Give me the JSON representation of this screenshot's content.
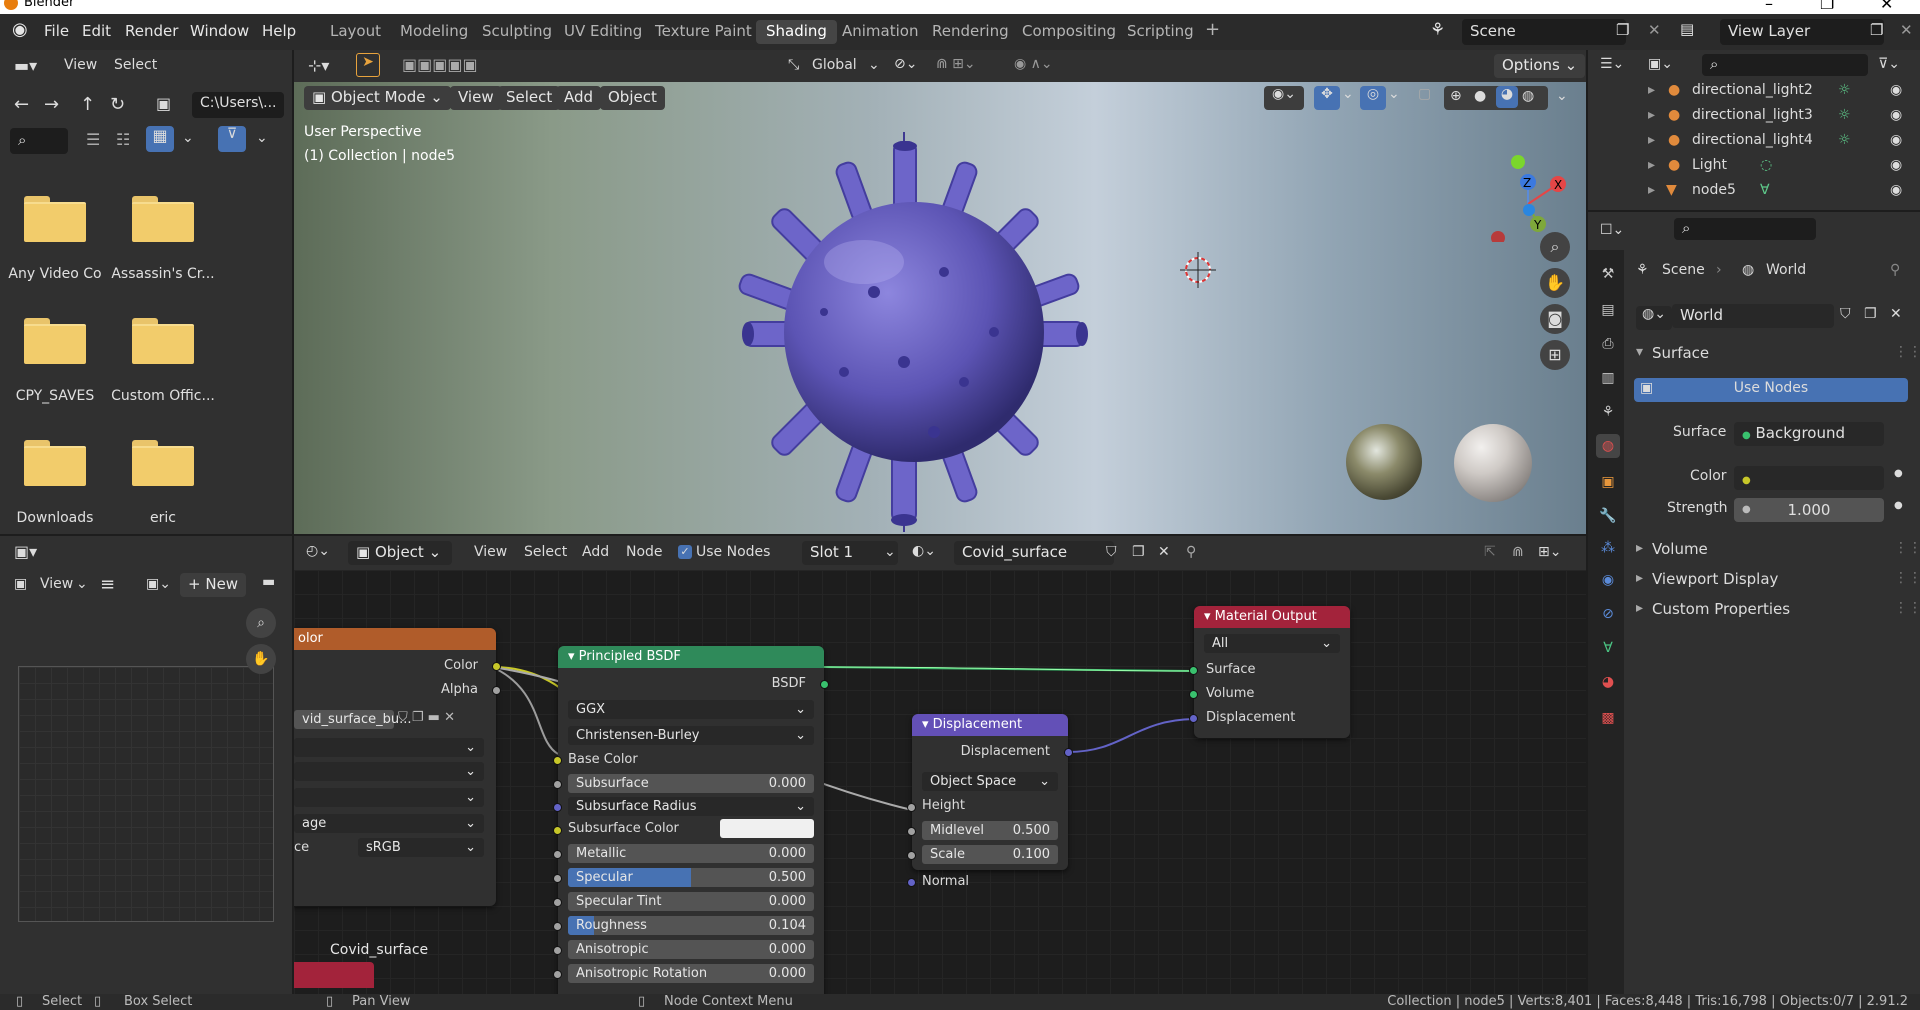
{
  "window": {
    "title": "Blender"
  },
  "menu": [
    "File",
    "Edit",
    "Render",
    "Window",
    "Help"
  ],
  "workspaces": [
    "Layout",
    "Modeling",
    "Sculpting",
    "UV Editing",
    "Texture Paint",
    "Shading",
    "Animation",
    "Rendering",
    "Compositing",
    "Scripting"
  ],
  "active_workspace": "Shading",
  "scene": "Scene",
  "view_layer": "View Layer",
  "filebrowser": {
    "menu": [
      "View",
      "Select"
    ],
    "path": "C:\\Users\\...",
    "folders": [
      "Any Video Co",
      "Assassin's Cr...",
      "CPY_SAVES",
      "Custom Offic...",
      "Downloads",
      "eric"
    ]
  },
  "viewport": {
    "header": {
      "global": "Global",
      "options": "Options"
    },
    "mode": "Object Mode",
    "menus": [
      "View",
      "Select",
      "Add",
      "Object"
    ],
    "info1": "User Perspective",
    "info2": "(1) Collection | node5",
    "gizmo": {
      "x": "X",
      "y": "Y",
      "z": "Z"
    }
  },
  "imageeditor": {
    "view": "View",
    "new": "New"
  },
  "nodeeditor": {
    "type": "Object",
    "menus": [
      "View",
      "Select",
      "Add",
      "Node"
    ],
    "use_nodes": "Use Nodes",
    "slot": "Slot 1",
    "material": "Covid_surface",
    "frame_label": "Covid_surface",
    "image_node": {
      "title": "olor",
      "out_color": "Color",
      "out_alpha": "Alpha",
      "image": "vid_surface_bu...",
      "row_age": "age",
      "row_ce": "ce",
      "colorspace": "sRGB"
    },
    "bsdf": {
      "title": "Principled BSDF",
      "out": "BSDF",
      "distribution": "GGX",
      "subsurface_method": "Christensen-Burley",
      "base_color": "Base Color",
      "subsurface": {
        "label": "Subsurface",
        "value": "0.000"
      },
      "subsurface_radius": "Subsurface Radius",
      "subsurface_color": "Subsurface Color",
      "metallic": {
        "label": "Metallic",
        "value": "0.000"
      },
      "specular": {
        "label": "Specular",
        "value": "0.500",
        "fill": 0.5
      },
      "specular_tint": {
        "label": "Specular Tint",
        "value": "0.000"
      },
      "roughness": {
        "label": "Roughness",
        "value": "0.104",
        "fill": 0.104
      },
      "anisotropic": {
        "label": "Anisotropic",
        "value": "0.000"
      },
      "anisotropic_rotation": {
        "label": "Anisotropic Rotation",
        "value": "0.000"
      }
    },
    "displacement": {
      "title": "Displacement",
      "out": "Displacement",
      "space": "Object Space",
      "height": "Height",
      "midlevel": {
        "label": "Midlevel",
        "value": "0.500"
      },
      "scale": {
        "label": "Scale",
        "value": "0.100"
      },
      "normal": "Normal"
    },
    "output": {
      "title": "Material Output",
      "target": "All",
      "surface": "Surface",
      "volume": "Volume",
      "displacement": "Displacement"
    }
  },
  "outliner": {
    "items": [
      "directional_light2",
      "directional_light3",
      "directional_light4",
      "Light",
      "node5"
    ]
  },
  "properties": {
    "breadcrumb": {
      "scene": "Scene",
      "world": "World"
    },
    "world_name": "World",
    "surface_panel": "Surface",
    "use_nodes": "Use Nodes",
    "surface_label": "Surface",
    "surface_value": "Background",
    "color_label": "Color",
    "strength_label": "Strength",
    "strength_value": "1.000",
    "panels": [
      "Volume",
      "Viewport Display",
      "Custom Properties"
    ]
  },
  "status": {
    "select": "Select",
    "box_select": "Box Select",
    "pan_view": "Pan View",
    "context_menu": "Node Context Menu",
    "stats": "Collection | node5 | Verts:8,401 | Faces:8,448 | Tris:16,798 | Objects:0/7 | 2.91.2"
  }
}
